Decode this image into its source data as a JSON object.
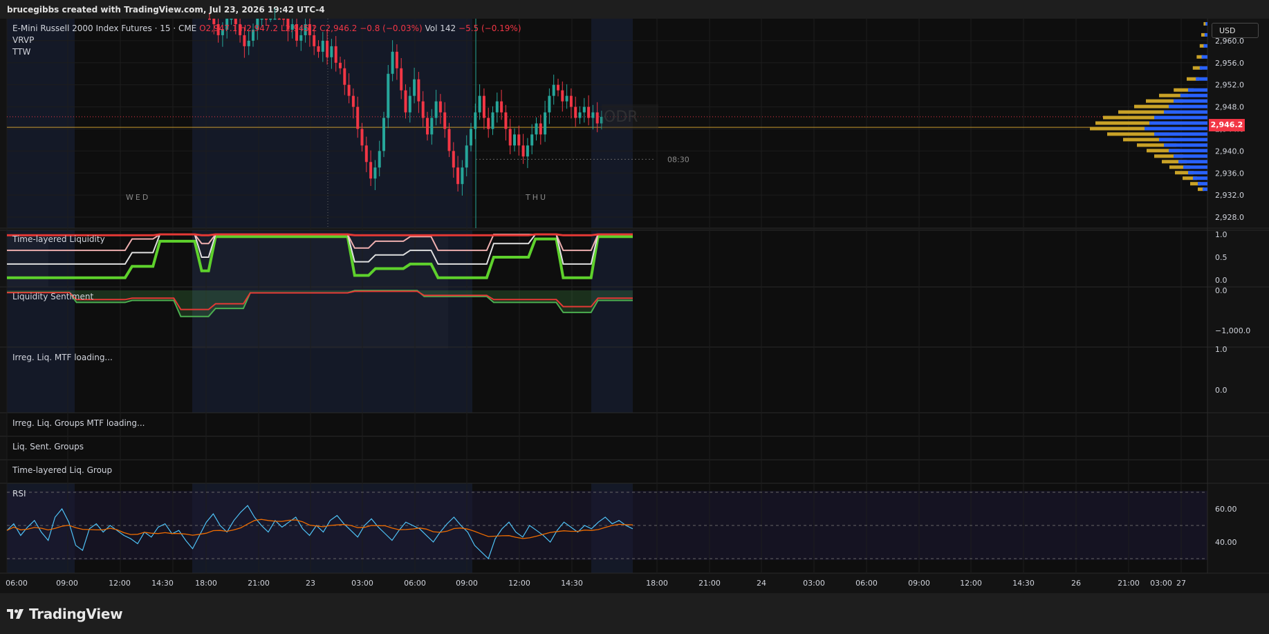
{
  "header": {
    "caption": "brucegibbs created with TradingView.com, Jul 23, 2026 19:42 UTC-4"
  },
  "legend": {
    "symbol": "E-Mini Russell 2000 Index Futures · 15 · CME",
    "o": "O2,947.1",
    "h": "H2,947.2",
    "l": "L2,945.2",
    "c": "C2,946.2",
    "chg": "−0.8 (−0.03%)",
    "vol": "Vol 142",
    "vol2": "−5.5 (−0.19%)",
    "ind1": "VRVP",
    "ind2": "TTW"
  },
  "currency": "USD",
  "last_price": "2,946.2",
  "price_axis": [
    "2,960.0",
    "2,956.0",
    "2,952.0",
    "2,948.0",
    "2,944.0",
    "2,940.0",
    "2,936.0",
    "2,932.0",
    "2,928.0"
  ],
  "session_labels": [
    "WED",
    "THU"
  ],
  "time_marker": "08:30",
  "watermark": "ODR",
  "panels": {
    "p1": {
      "title": "Time-layered Liquidity",
      "ticks": [
        "1.0",
        "0.5",
        "0.0"
      ]
    },
    "p2": {
      "title": "Liquidity Sentiment",
      "ticks": [
        "0.0",
        "−1,000.0"
      ]
    },
    "p3": {
      "title": "Irreg. Liq. MTF loading...",
      "ticks": [
        "1.0",
        "0.0"
      ]
    },
    "p4": {
      "title": "Irreg. Liq. Groups MTF loading..."
    },
    "p5": {
      "title": "Liq. Sent. Groups"
    },
    "p6": {
      "title": "Time-layered Liq. Group"
    },
    "rsi": {
      "title": "RSI",
      "ticks": [
        "60.00",
        "40.00"
      ]
    }
  },
  "time_axis": [
    "06:00",
    "09:00",
    "12:00",
    "14:30",
    "18:00",
    "21:00",
    "23",
    "03:00",
    "06:00",
    "09:00",
    "12:00",
    "14:30",
    "18:00",
    "21:00",
    "24",
    "03:00",
    "06:00",
    "09:00",
    "12:00",
    "14:30",
    "26",
    "21:00",
    "27",
    "03:00"
  ],
  "brand": "TradingView",
  "colors": {
    "up": "#26a69a",
    "down": "#f23645",
    "green": "#4caf50",
    "red": "#e53935",
    "profile_blue": "#2962ff",
    "profile_gold": "#c9a227"
  },
  "chart_data": {
    "type": "candlestick",
    "yrange": [
      2926,
      2964
    ],
    "candles_close": [
      2966,
      2963,
      2961,
      2962,
      2964,
      2965,
      2963,
      2961,
      2959,
      2960,
      2962,
      2964,
      2966,
      2965,
      2967,
      2968,
      2966,
      2964,
      2962,
      2963,
      2960,
      2961,
      2963,
      2961,
      2959,
      2958,
      2960,
      2957,
      2959,
      2956,
      2955,
      2952,
      2950,
      2948,
      2944,
      2941,
      2938,
      2935,
      2937,
      2940,
      2946,
      2954,
      2958,
      2955,
      2951,
      2947,
      2950,
      2953,
      2949,
      2946,
      2943,
      2946,
      2949,
      2947,
      2944,
      2940,
      2937,
      2934,
      2937,
      2941,
      2944,
      2947,
      2950,
      2946,
      2944,
      2947,
      2949,
      2947,
      2944,
      2941,
      2943,
      2941,
      2939,
      2941,
      2943,
      2945,
      2943,
      2947,
      2950,
      2952,
      2951,
      2949,
      2950,
      2948,
      2946,
      2947,
      2948,
      2946,
      2947,
      2945,
      2946.2
    ],
    "rsi": [
      47,
      51,
      44,
      49,
      53,
      46,
      41,
      55,
      60,
      52,
      38,
      35,
      48,
      51,
      46,
      50,
      47,
      44,
      42,
      39,
      46,
      43,
      49,
      51,
      45,
      47,
      41,
      36,
      44,
      52,
      57,
      50,
      46,
      53,
      58,
      62,
      55,
      50,
      46,
      53,
      49,
      52,
      55,
      48,
      44,
      50,
      46,
      53,
      56,
      51,
      47,
      43,
      50,
      54,
      49,
      45,
      41,
      47,
      52,
      50,
      48,
      44,
      40,
      46,
      51,
      55,
      50,
      46,
      38,
      34,
      30,
      42,
      48,
      52,
      46,
      43,
      50,
      47,
      44,
      40,
      47,
      52,
      49,
      46,
      50,
      48,
      52,
      55,
      51,
      53,
      50,
      48
    ]
  }
}
